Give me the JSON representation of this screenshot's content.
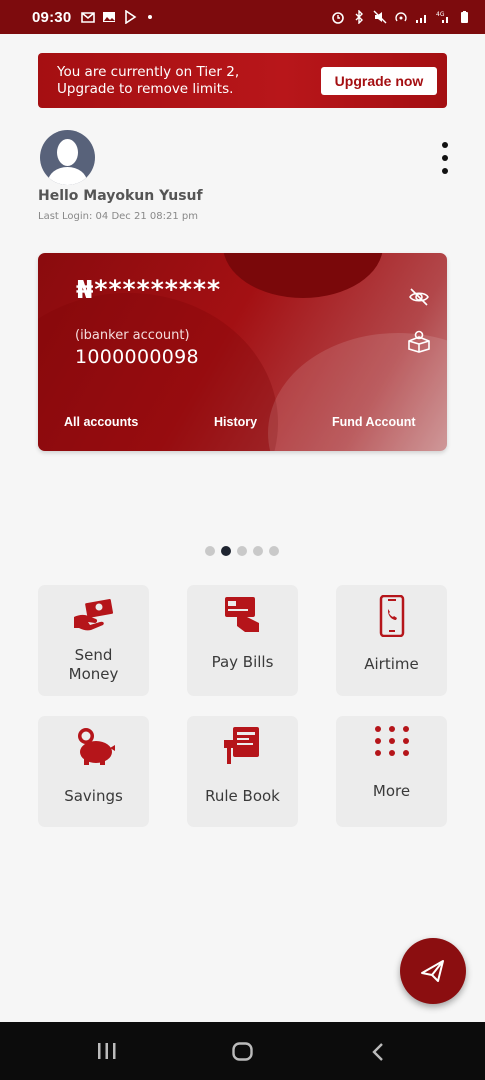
{
  "status_bar": {
    "time": "09:30",
    "left_icons": [
      "gmail-icon",
      "gallery-icon",
      "play-store-icon",
      "dot-icon"
    ],
    "right_icons": [
      "alarm-icon",
      "bluetooth-icon",
      "mute-icon",
      "hotspot-icon",
      "signal-icon",
      "4g-signal-icon",
      "battery-icon"
    ]
  },
  "banner": {
    "message_line1": "You are currently on Tier 2,",
    "message_line2": "Upgrade to remove limits.",
    "button_label": "Upgrade now"
  },
  "profile": {
    "greeting": "Hello Mayokun Yusuf",
    "last_login": "Last Login:  04 Dec 21 08:21 pm"
  },
  "account_card": {
    "balance_masked": "₦*********",
    "account_type": "(ibanker account)",
    "account_number": "1000000098",
    "links": [
      "All accounts",
      "History",
      "Fund Account"
    ]
  },
  "carousel": {
    "count": 5,
    "active_index": 1
  },
  "tiles": [
    {
      "label_line1": "Send",
      "label_line2": "Money",
      "icon": "send-money-icon"
    },
    {
      "label_line1": "Pay Bills",
      "label_line2": "",
      "icon": "pay-bills-icon"
    },
    {
      "label_line1": "Airtime",
      "label_line2": "",
      "icon": "airtime-icon"
    },
    {
      "label_line1": "Savings",
      "label_line2": "",
      "icon": "piggy-bank-icon"
    },
    {
      "label_line1": "Rule Book",
      "label_line2": "",
      "icon": "rule-book-icon"
    },
    {
      "label_line1": "More",
      "label_line2": "",
      "icon": "grid-dots-icon"
    }
  ],
  "fab": {
    "icon": "send-paper-plane-icon"
  },
  "colors": {
    "primary": "#8b0e10",
    "status_bar": "#7d0b0d",
    "tile_bg": "#ececec",
    "icon_red": "#b5151a"
  }
}
